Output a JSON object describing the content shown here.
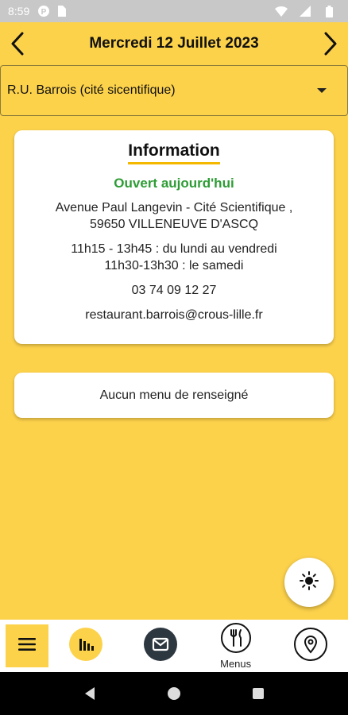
{
  "status_bar": {
    "time": "8:59",
    "icons_left": [
      "p-badge-icon",
      "sim-card-icon"
    ],
    "icons_right": [
      "wifi-icon",
      "signal-icon",
      "battery-icon"
    ]
  },
  "date_bar": {
    "title": "Mercredi 12 Juillet 2023",
    "prev_icon": "chevron-left-icon",
    "next_icon": "chevron-right-icon"
  },
  "restaurant_select": {
    "selected": "R.U. Barrois (cité sicentifique)"
  },
  "info_card": {
    "title": "Information",
    "status": "Ouvert aujourd'hui",
    "address_line1": "Avenue Paul Langevin - Cité Scientifique ,",
    "address_line2": "59650 VILLENEUVE D'ASCQ",
    "hours_line1": "11h15 - 13h45 : du lundi au vendredi",
    "hours_line2": "11h30-13h30 : le samedi",
    "phone": "03 74 09 12 27",
    "email": "restaurant.barrois@crous-lille.fr"
  },
  "menu_card": {
    "text": "Aucun menu de renseigné"
  },
  "fab": {
    "icon": "sun-icon"
  },
  "bottom_nav": {
    "items": [
      {
        "icon": "hamburger-menu-icon"
      },
      {
        "icon": "stats-icon"
      },
      {
        "icon": "mail-icon"
      },
      {
        "icon": "fork-knife-icon",
        "label": "Menus"
      },
      {
        "icon": "location-pin-icon"
      }
    ]
  },
  "colors": {
    "background": "#FDD24B",
    "open_status": "#2E9C35",
    "title_underline": "#F5B800",
    "status_bar": "#C8C8C8",
    "mail_icon_bg": "#2D3740"
  }
}
